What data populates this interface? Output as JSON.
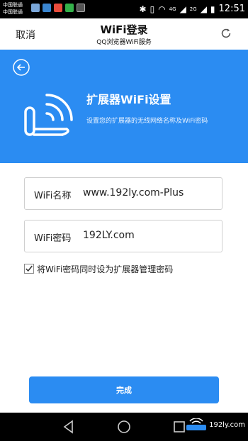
{
  "status_bar": {
    "carrier_line1": "中国联通",
    "carrier_line2": "中国联通",
    "network": "4G",
    "network2": "2G",
    "time": "12:51"
  },
  "header": {
    "cancel_label": "取消",
    "title": "WiFi登录",
    "subtitle": "QQ浏览器WiFi服务",
    "refresh_icon": "refresh-icon"
  },
  "banner": {
    "background_color": "#2b8cf2",
    "title": "扩展器WiFi设置",
    "description": "设置您的扩展器的无线网络名称及WiFi密码"
  },
  "form": {
    "wifi_name_label": "WiFi名称",
    "wifi_name_value": "www.192ly.com-Plus",
    "wifi_password_label": "WiFi密码",
    "wifi_password_value": "192LY.com",
    "checkbox_label": "将WiFi密码同时设为扩展器管理密码",
    "checkbox_checked": true
  },
  "actions": {
    "done_label": "完成"
  },
  "watermark": {
    "text": "192ly.com"
  }
}
